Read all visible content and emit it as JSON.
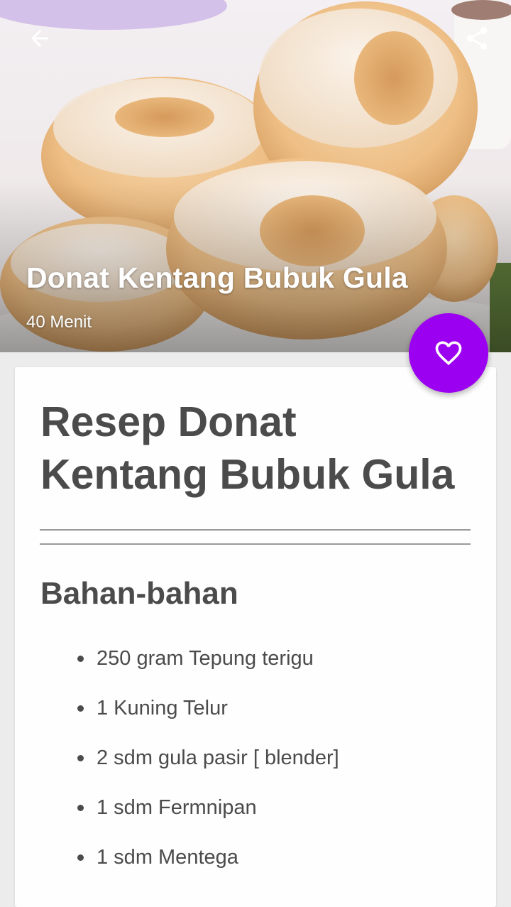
{
  "header": {
    "title": "Donat Kentang Bubuk Gula",
    "duration": "40 Menit"
  },
  "icons": {
    "back": "arrow-left-icon",
    "share": "share-icon",
    "favorite": "heart-outline-icon"
  },
  "colors": {
    "accent": "#9b00f0",
    "text": "#4b4b4b",
    "background": "#ececec"
  },
  "content": {
    "recipe_title": "Resep Donat Kentang Bubuk Gula",
    "ingredients_heading": "Bahan-bahan",
    "ingredients": [
      "250 gram Tepung terigu",
      "1 Kuning Telur",
      "2 sdm gula pasir [ blender]",
      "1 sdm Fermnipan",
      "1 sdm Mentega"
    ]
  }
}
